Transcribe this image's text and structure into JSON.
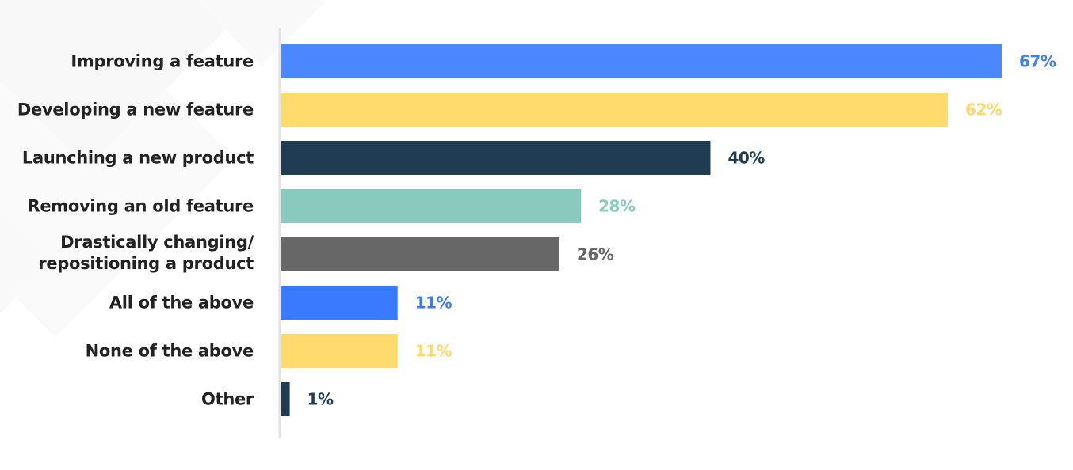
{
  "chart_data": {
    "type": "bar",
    "orientation": "horizontal",
    "title": "",
    "xlabel": "",
    "ylabel": "",
    "xlim": [
      0,
      67
    ],
    "grid": false,
    "legend": "none",
    "unit": "%",
    "categories": [
      "Improving a feature",
      "Developing a new feature",
      "Launching a new product",
      "Removing an old feature",
      "Drastically changing/\nrepositioning a product",
      "All of the above",
      "None of the above",
      "Other"
    ],
    "values": [
      67,
      62,
      40,
      28,
      26,
      11,
      11,
      1
    ],
    "value_labels": [
      "67%",
      "62%",
      "40%",
      "28%",
      "26%",
      "11%",
      "11%",
      "1%"
    ],
    "bar_colors": [
      "#4b88ff",
      "#ffdb6e",
      "#1f3c53",
      "#88cbbe",
      "#676767",
      "#3a7aff",
      "#ffdb6e",
      "#1f3c53"
    ],
    "label_colors": [
      "#3f7ff5",
      "#ffd86a",
      "#1f3c53",
      "#88cbbe",
      "#676767",
      "#3a7aff",
      "#ffd86a",
      "#1f3c53"
    ]
  },
  "colors": {
    "category_text": "#222222",
    "axis_line": "#e3e3e3"
  }
}
